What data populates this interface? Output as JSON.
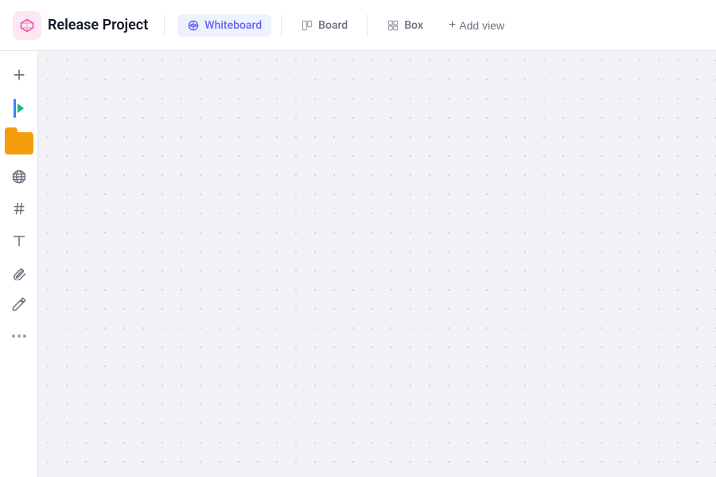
{
  "header": {
    "project_title": "Release Project",
    "tabs": [
      {
        "id": "whiteboard",
        "label": "Whiteboard",
        "active": true
      },
      {
        "id": "board",
        "label": "Board",
        "active": false
      },
      {
        "id": "box",
        "label": "Box",
        "active": false
      }
    ],
    "add_view_label": "Add view"
  },
  "sidebar": {
    "items": [
      {
        "id": "add",
        "icon": "plus-icon",
        "label": "Add"
      },
      {
        "id": "media",
        "icon": "media-icon",
        "label": "Media"
      },
      {
        "id": "files",
        "icon": "files-icon",
        "label": "Files"
      },
      {
        "id": "globe",
        "icon": "globe-icon",
        "label": "Globe"
      },
      {
        "id": "hash",
        "icon": "hash-icon",
        "label": "Hash"
      },
      {
        "id": "text",
        "icon": "text-icon",
        "label": "Text"
      },
      {
        "id": "attach",
        "icon": "attach-icon",
        "label": "Attach"
      },
      {
        "id": "draw",
        "icon": "draw-icon",
        "label": "Draw"
      },
      {
        "id": "more",
        "icon": "more-icon",
        "label": "More"
      }
    ]
  },
  "canvas": {
    "background_color": "#f0f2f5",
    "dot_color": "#c8cbd0"
  },
  "colors": {
    "accent_purple": "#6366f1",
    "accent_blue": "#3b82f6",
    "accent_green": "#10b981",
    "accent_amber": "#f59e0b",
    "project_icon_bg": "#fce7f3",
    "project_icon_color": "#ec4899"
  }
}
